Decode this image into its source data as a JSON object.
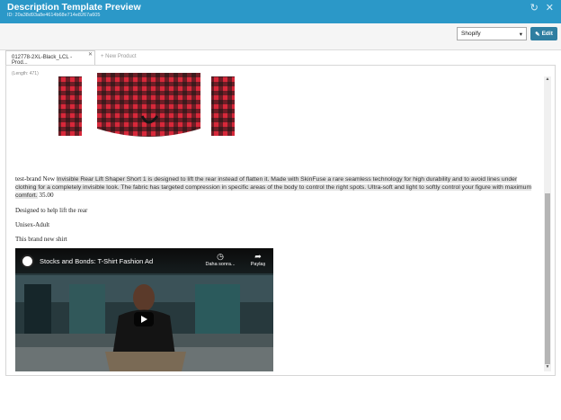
{
  "window": {
    "title": "Description Template Preview",
    "subtitle": "ID: 20a38d93a8e4614b68e714e8267a605",
    "refresh_icon": "refresh-icon",
    "close_icon": "close-icon"
  },
  "toolbar": {
    "platform_selected": "Shopify",
    "edit_label": "Edit"
  },
  "tabs": [
    {
      "label": "012778-2XL-Black_LCL - Prod...",
      "active": true
    },
    {
      "label": "+ New Product",
      "active": false
    }
  ],
  "content": {
    "length_label": "(Length: 471)",
    "description_prefix": "test-brand New ",
    "description_highlight": "Invisible Rear Lift Shaper Short 1 is designed to lift the rear instead of flatten it. Made with SkinFuse a rare seamless technology for high durability and to avoid lines under clothing for a completely invisible look. The fabric has targeted compression in specific areas of the body to control the right spots. Ultra-soft and light to softly control your figure with maximum comfort.",
    "description_suffix": " 35.00",
    "line1": "Designed to help lift the rear",
    "line2": "Unisex-Adult",
    "line3": "This brand new shirt"
  },
  "video": {
    "title": "Stocks and Bonds: T-Shirt Fashion Ad",
    "watch_later_label": "Daha sonra...",
    "share_label": "Paylaş"
  },
  "colors": {
    "titlebar": "#2b98c8",
    "edit_button": "#2f7ea1",
    "plaid_red": "#d8283a",
    "plaid_black": "#151515"
  }
}
